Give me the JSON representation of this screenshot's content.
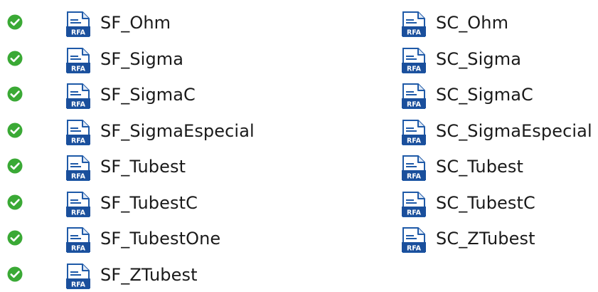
{
  "colors": {
    "status_ok": "#3aa935",
    "icon_blue": "#1f5aa8",
    "icon_badge": "#1a4f9c"
  },
  "icons": {
    "status": "check-circle-icon",
    "file": "rfa-file-icon",
    "file_badge_text": "RFA"
  },
  "left_column": {
    "items": [
      {
        "name": "SF_Ohm",
        "synced": true
      },
      {
        "name": "SF_Sigma",
        "synced": true
      },
      {
        "name": "SF_SigmaC",
        "synced": true
      },
      {
        "name": "SF_SigmaEspecial",
        "synced": true
      },
      {
        "name": "SF_Tubest",
        "synced": true
      },
      {
        "name": "SF_TubestC",
        "synced": true
      },
      {
        "name": "SF_TubestOne",
        "synced": true
      },
      {
        "name": "SF_ZTubest",
        "synced": true
      }
    ]
  },
  "right_column": {
    "items": [
      {
        "name": "SC_Ohm"
      },
      {
        "name": "SC_Sigma"
      },
      {
        "name": "SC_SigmaC"
      },
      {
        "name": "SC_SigmaEspecial"
      },
      {
        "name": "SC_Tubest"
      },
      {
        "name": "SC_TubestC"
      },
      {
        "name": "SC_ZTubest"
      }
    ]
  }
}
